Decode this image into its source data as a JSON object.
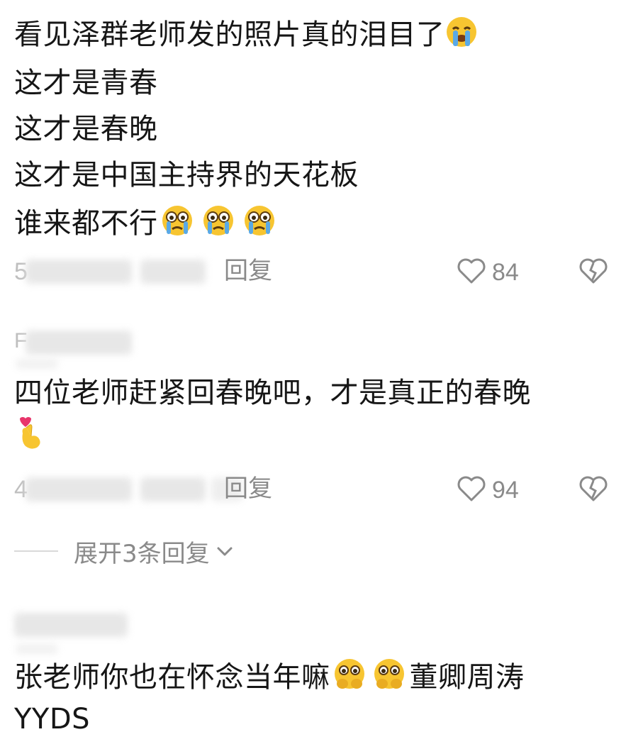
{
  "comments": [
    {
      "lines": [
        "看见泽群老师发的照片真的泪目了",
        "这才是青春",
        "这才是春晚",
        "这才是中国主持界的天花板",
        "谁来都不行"
      ],
      "meta_digit": "5",
      "reply_label": "回复",
      "likes": "84"
    },
    {
      "username_initial": "F",
      "lines": [
        "四位老师赶紧回春晚吧，才是真正的春晚"
      ],
      "meta_digit": "4",
      "reply_label": "回复",
      "likes": "94"
    },
    {
      "lines": [
        "张老师你也在怀念当年嘛",
        "董卿周涛",
        "YYDS"
      ]
    }
  ],
  "expand": {
    "label": "展开3条回复"
  },
  "icons": {
    "like": "heart-outline-icon",
    "dislike": "broken-heart-icon",
    "expand": "chevron-down-icon"
  },
  "colors": {
    "text": "#161616",
    "muted": "#8a8a8a",
    "emoji_yellow": "#f7c531",
    "tear_blue": "#5aa9e6"
  }
}
